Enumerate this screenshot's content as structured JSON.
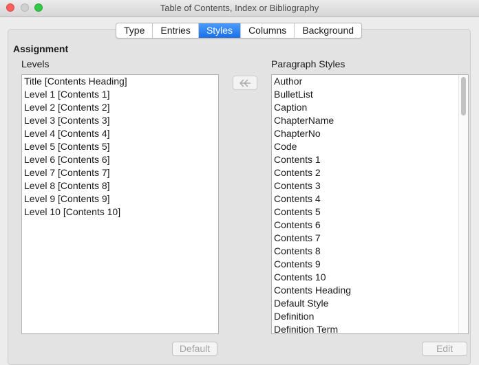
{
  "window": {
    "title": "Table of Contents, Index or Bibliography"
  },
  "tabs": [
    {
      "label": "Type"
    },
    {
      "label": "Entries"
    },
    {
      "label": "Styles",
      "active": true
    },
    {
      "label": "Columns"
    },
    {
      "label": "Background"
    }
  ],
  "assignment": {
    "title": "Assignment",
    "levels_label": "Levels",
    "paragraph_styles_label": "Paragraph Styles",
    "levels": [
      "Title [Contents Heading]",
      "Level 1 [Contents 1]",
      "Level 2 [Contents 2]",
      "Level 3 [Contents 3]",
      "Level 4 [Contents 4]",
      "Level 5 [Contents 5]",
      "Level 6 [Contents 6]",
      "Level 7 [Contents 7]",
      "Level 8 [Contents 8]",
      "Level 9 [Contents 9]",
      "Level 10 [Contents 10]"
    ],
    "paragraph_styles": [
      "Author",
      "BulletList",
      "Caption",
      "ChapterName",
      "ChapterNo",
      "Code",
      "Contents 1",
      "Contents 2",
      "Contents 3",
      "Contents 4",
      "Contents 5",
      "Contents 6",
      "Contents 7",
      "Contents 8",
      "Contents 9",
      "Contents 10",
      "Contents Heading",
      "Default Style",
      "Definition",
      "Definition Term"
    ],
    "assign_icon": "double-arrow-left-icon",
    "default_button": "Default",
    "edit_button": "Edit"
  },
  "colors": {
    "active_tab": "#1a70e8",
    "window_bg": "#ececec",
    "disabled_text": "#a3a3a3"
  }
}
